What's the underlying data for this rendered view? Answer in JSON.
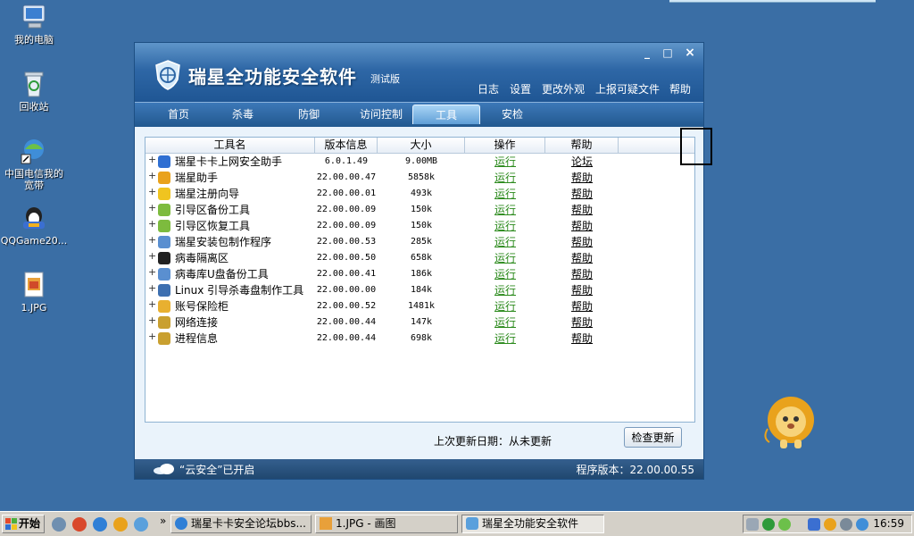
{
  "desktop_icons": [
    {
      "name": "my-computer",
      "label": "我的电脑"
    },
    {
      "name": "recycle-bin",
      "label": "回收站"
    },
    {
      "name": "broadband",
      "label": "中国电信我的宽带"
    },
    {
      "name": "qqgame",
      "label": "QQGame20..."
    },
    {
      "name": "jpg-file",
      "label": "1.JPG"
    }
  ],
  "window": {
    "title": "瑞星全功能安全软件",
    "edition": "测试版",
    "controls": {
      "minimize": "_",
      "maximize": "□",
      "close": "×"
    },
    "top_links": [
      "日志",
      "设置",
      "更改外观",
      "上报可疑文件",
      "帮助"
    ],
    "tabs": [
      "首页",
      "杀毒",
      "防御",
      "访问控制",
      "工具",
      "安检"
    ],
    "active_tab": "工具",
    "table": {
      "headers": [
        "工具名",
        "版本信息",
        "大小",
        "操作",
        "帮助"
      ],
      "rows": [
        {
          "name": "瑞星卡卡上网安全助手",
          "version": "6.0.1.49",
          "size": "9.00MB",
          "action": "运行",
          "help": "论坛"
        },
        {
          "name": "瑞星助手",
          "version": "22.00.00.47",
          "size": "5858k",
          "action": "运行",
          "help": "帮助"
        },
        {
          "name": "瑞星注册向导",
          "version": "22.00.00.01",
          "size": "493k",
          "action": "运行",
          "help": "帮助"
        },
        {
          "name": "引导区备份工具",
          "version": "22.00.00.09",
          "size": "150k",
          "action": "运行",
          "help": "帮助"
        },
        {
          "name": "引导区恢复工具",
          "version": "22.00.00.09",
          "size": "150k",
          "action": "运行",
          "help": "帮助"
        },
        {
          "name": "瑞星安装包制作程序",
          "version": "22.00.00.53",
          "size": "285k",
          "action": "运行",
          "help": "帮助"
        },
        {
          "name": "病毒隔离区",
          "version": "22.00.00.50",
          "size": "658k",
          "action": "运行",
          "help": "帮助"
        },
        {
          "name": "病毒库U盘备份工具",
          "version": "22.00.00.41",
          "size": "186k",
          "action": "运行",
          "help": "帮助"
        },
        {
          "name": "Linux 引导杀毒盘制作工具",
          "version": "22.00.00.00",
          "size": "184k",
          "action": "运行",
          "help": "帮助"
        },
        {
          "name": "账号保险柜",
          "version": "22.00.00.52",
          "size": "1481k",
          "action": "运行",
          "help": "帮助"
        },
        {
          "name": "网络连接",
          "version": "22.00.00.44",
          "size": "147k",
          "action": "运行",
          "help": "帮助"
        },
        {
          "name": "进程信息",
          "version": "22.00.00.44",
          "size": "698k",
          "action": "运行",
          "help": "帮助"
        }
      ]
    },
    "last_update": "上次更新日期：从未更新",
    "check_update_label": "检查更新",
    "cloud_status": "“云安全”已开启",
    "program_version": "程序版本：22.00.00.55"
  },
  "taskbar": {
    "start_label": "开始",
    "overflow": "»",
    "tasks": [
      {
        "label": "瑞星卡卡安全论坛bbs...",
        "active": false
      },
      {
        "label": "1.JPG - 画图",
        "active": false
      },
      {
        "label": "瑞星全功能安全软件",
        "active": true
      }
    ],
    "clock": "16:59"
  },
  "colors": {
    "desktop": "#3a6ea5",
    "header": "#2e67a6",
    "run_link": "#2b8a1c"
  }
}
